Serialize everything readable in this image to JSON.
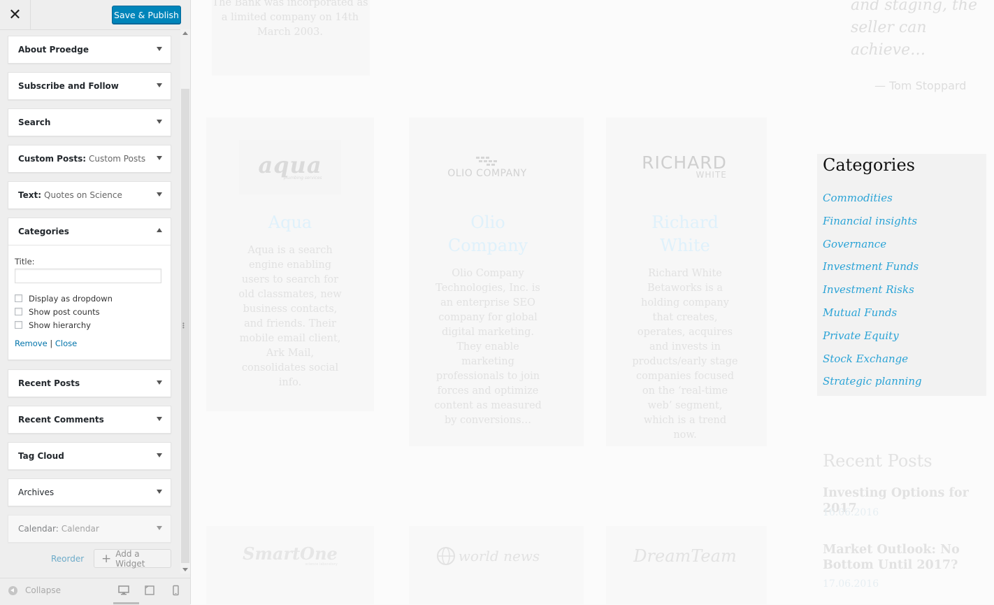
{
  "customizer": {
    "close_icon": "close-icon",
    "save_button": "Save & Publish",
    "widgets": [
      {
        "name": "About Proedge",
        "sub": ""
      },
      {
        "name": "Subscribe and Follow",
        "sub": ""
      },
      {
        "name": "Search",
        "sub": ""
      },
      {
        "name": "Custom Posts:",
        "sub": "Custom Posts"
      },
      {
        "name": "Text:",
        "sub": "Quotes on Science"
      },
      {
        "name": "Categories",
        "sub": ""
      },
      {
        "name": "Recent Posts",
        "sub": ""
      },
      {
        "name": "Recent Comments",
        "sub": ""
      },
      {
        "name": "Tag Cloud",
        "sub": ""
      },
      {
        "name": "Archives",
        "sub": ""
      },
      {
        "name": "Calendar:",
        "sub": "Calendar"
      }
    ],
    "categories_form": {
      "title_label": "Title:",
      "title_value": "",
      "options": [
        "Display as dropdown",
        "Show post counts",
        "Show hierarchy"
      ],
      "remove_link": "Remove",
      "separator": "|",
      "close_link": "Close"
    },
    "reorder": "Reorder",
    "add_widget": "Add a Widget",
    "collapse": "Collapse",
    "devices": [
      "desktop",
      "tablet",
      "mobile"
    ],
    "active_device": "desktop"
  },
  "preview": {
    "top_text": "The Bank was incorporated as a limited company on 14th March 2003.",
    "quote_text": "and staging, the seller can achieve…",
    "quote_author": "— Tom Stoppard",
    "clients": [
      {
        "logo": "aqua",
        "logo_sub": "plumbing services",
        "name": "Aqua",
        "desc": "Aqua is a search engine enabling users to search for old classmates, new business contacts, and friends. Their mobile email client, Ark Mail, consolidates social info."
      },
      {
        "logo": "OLIO COMPANY",
        "logo_sub": "",
        "name": "Olio Company",
        "desc": "Olio Company Technologies, Inc. is an enterprise SEO company for global digital marketing. They enable marketing professionals to join forces and optimize content as measured by conversions…"
      },
      {
        "logo": "RICHARD",
        "logo_sub": "WHITE",
        "name": "Richard White",
        "desc": "Richard White Betaworks is a holding company that creates, operates, acquires and invests in products/early stage companies focused on the ‘real-time web’ segment, which is a trend now."
      }
    ],
    "categories": {
      "title": "Categories",
      "items": [
        "Commodities",
        "Financial insights",
        "Governance",
        "Investment Funds",
        "Investment Risks",
        "Mutual Funds",
        "Private Equity",
        "Stock Exchange",
        "Strategic planning"
      ]
    },
    "recent_posts": {
      "title": "Recent Posts",
      "posts": [
        {
          "title": "Investing Options for 2017",
          "date": "16.06.2016"
        },
        {
          "title": "Market Outlook: No Bottom Until 2017?",
          "date": "17.06.2016"
        }
      ]
    },
    "bottom_logos": [
      "SmartOne",
      "world news",
      "DreamTeam"
    ],
    "bottom_logo_sub": "science laboratory"
  },
  "colors": {
    "publish_button": "#0085ba",
    "link": "#0073aa",
    "category_link": "#2aa3d6"
  }
}
